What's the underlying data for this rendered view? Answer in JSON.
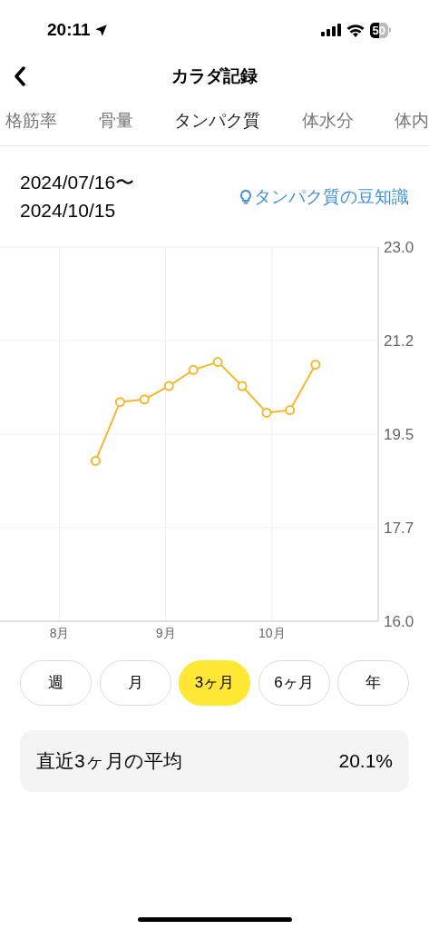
{
  "status_bar": {
    "time": "20:11",
    "battery": "50"
  },
  "nav": {
    "title": "カラダ記録"
  },
  "tabs": [
    {
      "label": "格筋率",
      "selected": false
    },
    {
      "label": "骨量",
      "selected": false
    },
    {
      "label": "タンパク質",
      "selected": true
    },
    {
      "label": "体水分",
      "selected": false
    },
    {
      "label": "体内",
      "selected": false
    }
  ],
  "date_range": {
    "start": "2024/07/16〜",
    "end": "2024/10/15"
  },
  "tip_link": "タンパク質の豆知識",
  "chart_data": {
    "type": "line",
    "grid": true,
    "xlim": [
      7.44,
      11.0
    ],
    "ylim": [
      16.0,
      23.0
    ],
    "xticks": [
      {
        "value": 8,
        "label": "8月"
      },
      {
        "value": 9,
        "label": "9月"
      },
      {
        "value": 10,
        "label": "10月"
      }
    ],
    "yticks": [
      {
        "value": 16.0,
        "label": "16.0"
      },
      {
        "value": 17.75,
        "label": "17.7"
      },
      {
        "value": 19.5,
        "label": "19.5"
      },
      {
        "value": 21.25,
        "label": "21.2"
      },
      {
        "value": 23.0,
        "label": "23.0"
      }
    ],
    "x": [
      8.34,
      8.57,
      8.8,
      9.03,
      9.26,
      9.49,
      9.72,
      9.95,
      10.17,
      10.41
    ],
    "series": [
      {
        "color": "#f5b82e",
        "marker": "o",
        "values": [
          19.0,
          20.1,
          20.15,
          20.4,
          20.7,
          20.85,
          20.4,
          19.9,
          19.95,
          20.8
        ]
      }
    ]
  },
  "periods": [
    {
      "label": "週",
      "selected": false
    },
    {
      "label": "月",
      "selected": false
    },
    {
      "label": "3ヶ月",
      "selected": true
    },
    {
      "label": "6ヶ月",
      "selected": false
    },
    {
      "label": "年",
      "selected": false
    }
  ],
  "average": {
    "label": "直近3ヶ月の平均",
    "value": "20.1%"
  }
}
